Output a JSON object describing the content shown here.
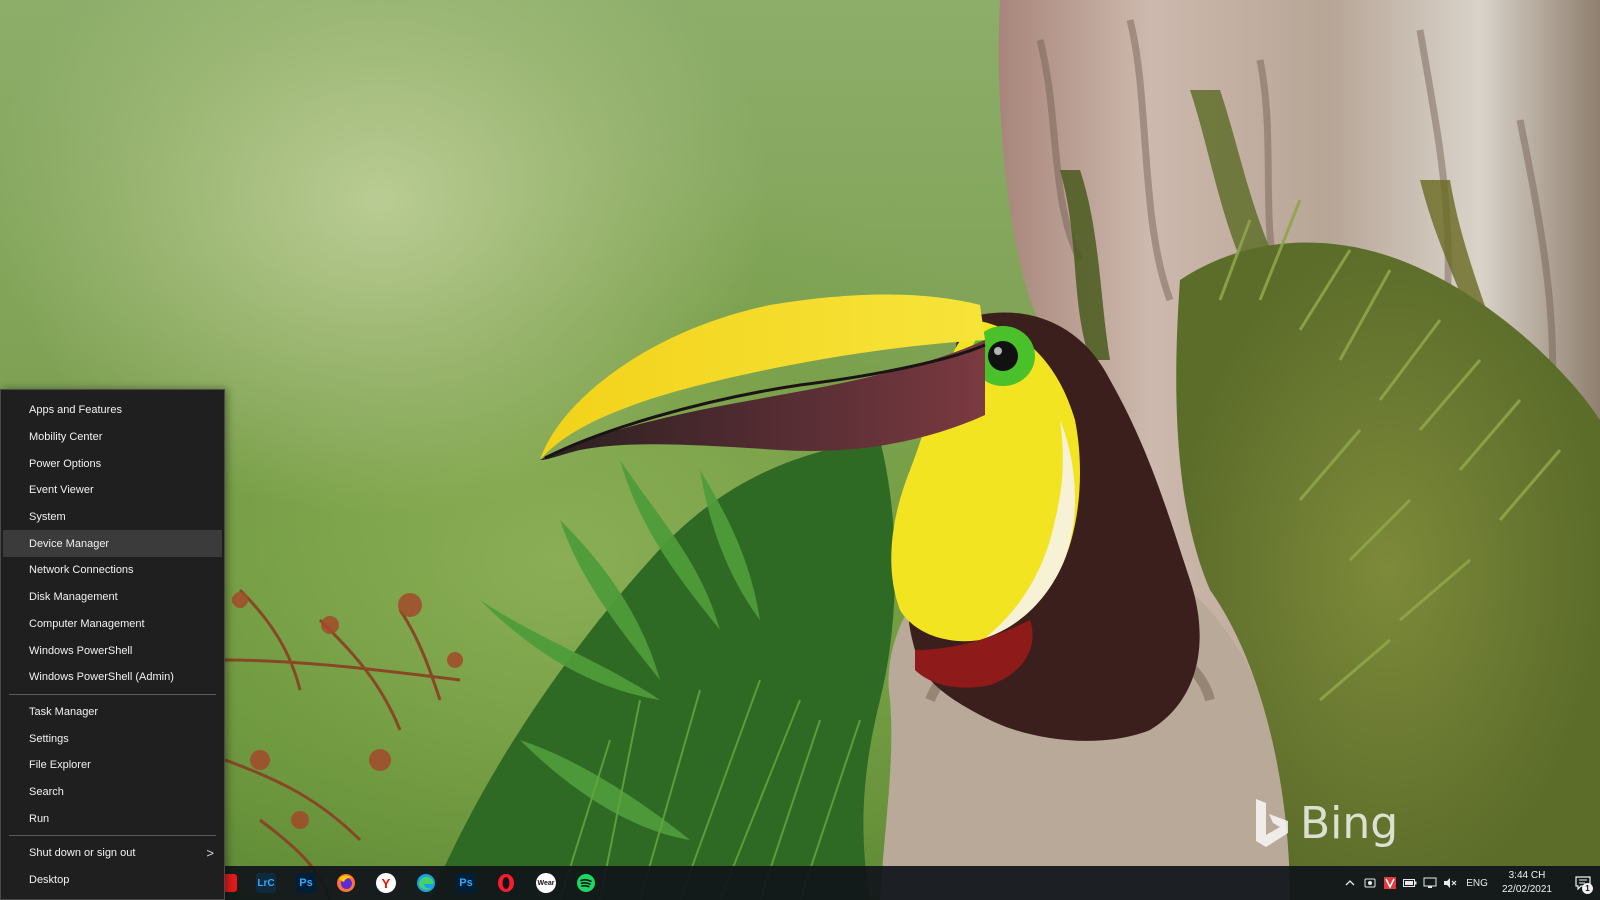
{
  "winx_menu": {
    "groups": [
      [
        "Apps and Features",
        "Mobility Center",
        "Power Options",
        "Event Viewer",
        "System",
        "Device Manager",
        "Network Connections",
        "Disk Management",
        "Computer Management",
        "Windows PowerShell",
        "Windows PowerShell (Admin)"
      ],
      [
        "Task Manager",
        "Settings",
        "File Explorer",
        "Search",
        "Run"
      ],
      [
        "Shut down or sign out",
        "Desktop"
      ]
    ],
    "highlighted": "Device Manager",
    "submenu_arrow": ">"
  },
  "taskbar": {
    "apps": [
      {
        "name": "red-app-icon",
        "label": "",
        "color": "#e21b1b"
      },
      {
        "name": "lightroom-classic-icon",
        "label": "LrC",
        "color": "#0f2a3d",
        "fg": "#31a8ff"
      },
      {
        "name": "photoshop-icon",
        "label": "Ps",
        "color": "#001e36",
        "fg": "#31a8ff"
      },
      {
        "name": "firefox-icon",
        "label": "",
        "color": "#ff7139"
      },
      {
        "name": "yandex-browser-icon",
        "label": "Y",
        "color": "#ffffff",
        "fg": "#e61400"
      },
      {
        "name": "edge-icon",
        "label": "",
        "color": "#1ba1e2"
      },
      {
        "name": "photoshop-icon",
        "label": "Ps",
        "color": "#001e36",
        "fg": "#31a8ff"
      },
      {
        "name": "opera-icon",
        "label": "",
        "color": "#ff1b2d"
      },
      {
        "name": "wear-app-icon",
        "label": "Wear",
        "color": "#ffffff",
        "fg": "#111111"
      },
      {
        "name": "spotify-icon",
        "label": "",
        "color": "#1ed760"
      }
    ],
    "tray": {
      "language": "ENG",
      "time": "3:44 CH",
      "date": "22/02/2021",
      "notification_count": "1"
    }
  },
  "wallpaper": {
    "watermark": "Bing"
  }
}
